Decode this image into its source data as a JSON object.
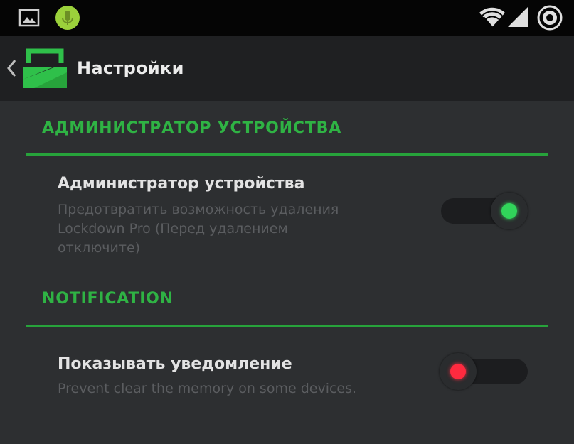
{
  "status_bar": {
    "icons": [
      "image-notification-icon",
      "android-notification-icon",
      "wifi-icon",
      "signal-icon",
      "battery-icon"
    ],
    "colors": {
      "background": "#050505",
      "android": "#9bd13b"
    }
  },
  "action_bar": {
    "title": "Настройки",
    "icons": [
      "back-chevron-icon",
      "lockdown-logo-icon"
    ]
  },
  "sections": [
    {
      "header": "АДМИНИСТРАТОР УСТРОЙСТВА",
      "preference": {
        "title": "Администратор устройства",
        "summary_lines": [
          "Предотвратить возможность удаления",
          "Lockdown Pro (Перед удалением",
          "отключите)"
        ],
        "enabled": true
      }
    },
    {
      "header": "NOTIFICATION",
      "preference": {
        "title": "Показывать уведомление",
        "summary_lines": [
          "Prevent clear the memory on some devices."
        ],
        "enabled": false
      }
    }
  ],
  "colors": {
    "accent_green": "#2fb344",
    "toggle_on": "#31d45a",
    "toggle_off": "#ff2a3f",
    "background": "#2d2f31"
  }
}
